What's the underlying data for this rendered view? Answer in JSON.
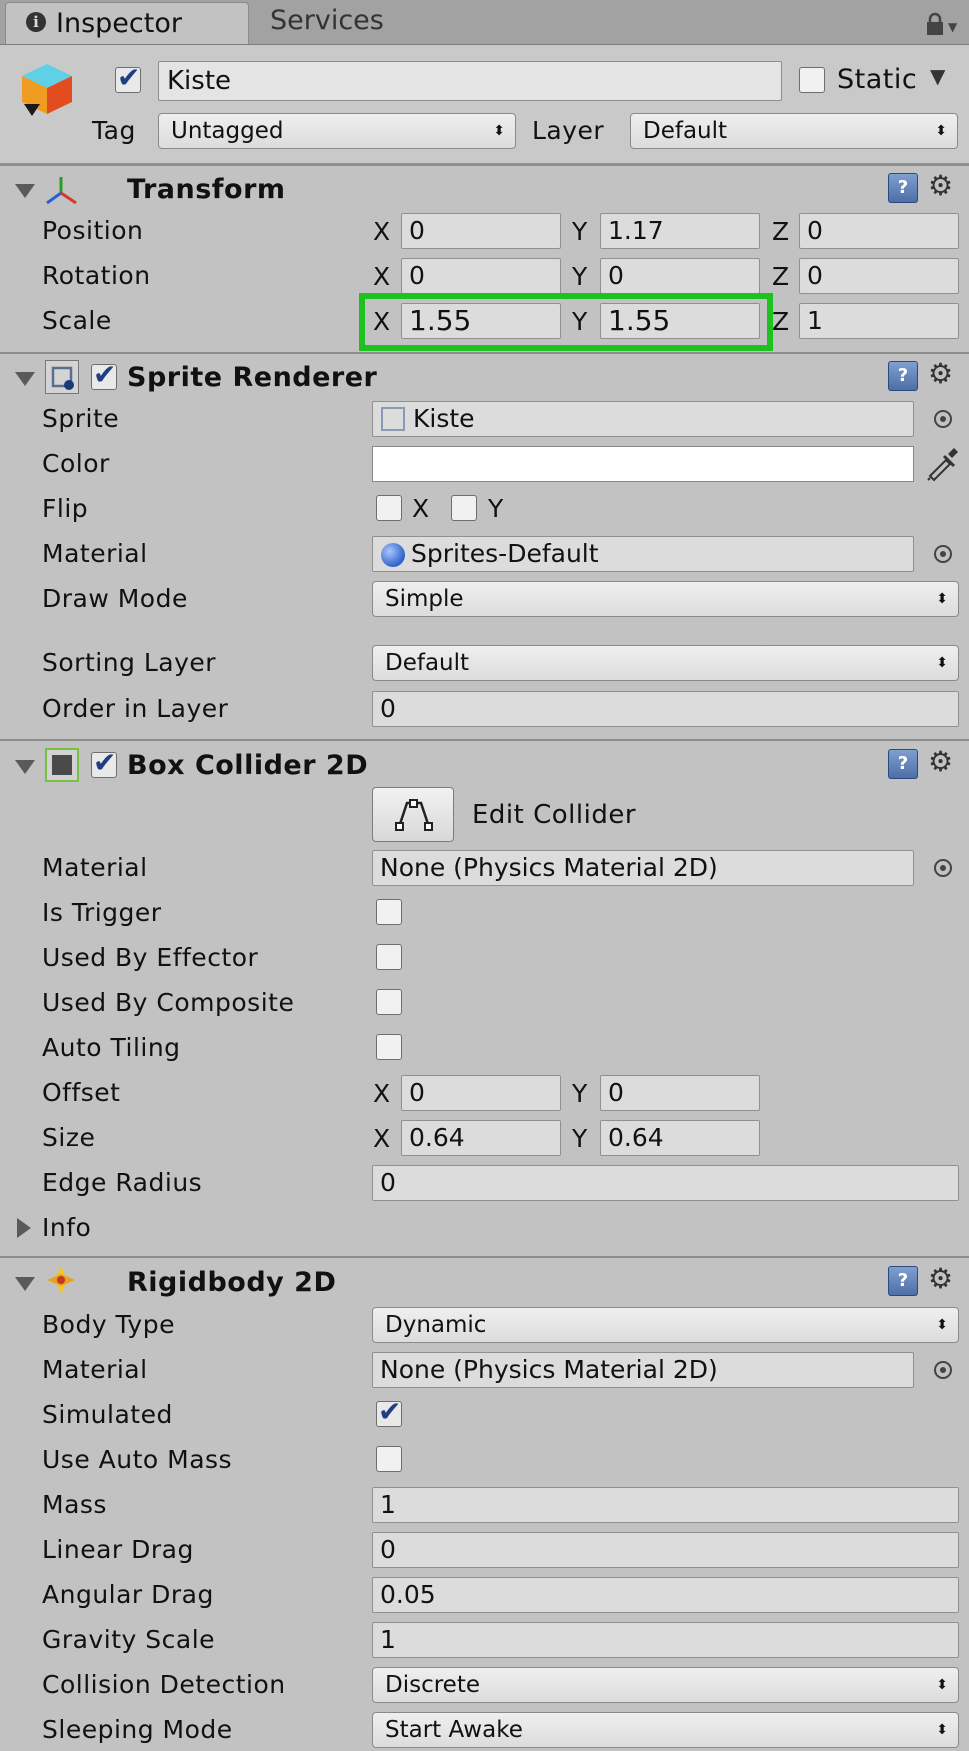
{
  "tabs": {
    "inspector": "Inspector",
    "services": "Services"
  },
  "object": {
    "name": "Kiste",
    "static_label": "Static",
    "tag_label": "Tag",
    "tag_value": "Untagged",
    "layer_label": "Layer",
    "layer_value": "Default"
  },
  "transform": {
    "title": "Transform",
    "position_label": "Position",
    "rotation_label": "Rotation",
    "scale_label": "Scale",
    "position": {
      "x": "0",
      "y": "1.17",
      "z": "0"
    },
    "rotation": {
      "x": "0",
      "y": "0",
      "z": "0"
    },
    "scale": {
      "x": "1.55",
      "y": "1.55",
      "z": "1"
    }
  },
  "axes": {
    "x": "X",
    "y": "Y",
    "z": "Z"
  },
  "sprite_renderer": {
    "title": "Sprite Renderer",
    "sprite_label": "Sprite",
    "sprite_value": "Kiste",
    "color_label": "Color",
    "color_value": "#ffffff",
    "flip_label": "Flip",
    "material_label": "Material",
    "material_value": "Sprites-Default",
    "draw_mode_label": "Draw Mode",
    "draw_mode_value": "Simple",
    "sorting_layer_label": "Sorting Layer",
    "sorting_layer_value": "Default",
    "order_label": "Order in Layer",
    "order_value": "0"
  },
  "box_collider": {
    "title": "Box Collider 2D",
    "edit_collider": "Edit Collider",
    "material_label": "Material",
    "material_value": "None (Physics Material 2D)",
    "is_trigger_label": "Is Trigger",
    "used_by_effector_label": "Used By Effector",
    "used_by_composite_label": "Used By Composite",
    "auto_tiling_label": "Auto Tiling",
    "offset_label": "Offset",
    "offset": {
      "x": "0",
      "y": "0"
    },
    "size_label": "Size",
    "size": {
      "x": "0.64",
      "y": "0.64"
    },
    "edge_radius_label": "Edge Radius",
    "edge_radius_value": "0",
    "info_label": "Info"
  },
  "rigidbody": {
    "title": "Rigidbody 2D",
    "body_type_label": "Body Type",
    "body_type_value": "Dynamic",
    "material_label": "Material",
    "material_value": "None (Physics Material 2D)",
    "simulated_label": "Simulated",
    "use_auto_mass_label": "Use Auto Mass",
    "mass_label": "Mass",
    "mass_value": "1",
    "linear_drag_label": "Linear Drag",
    "linear_drag_value": "0",
    "angular_drag_label": "Angular Drag",
    "angular_drag_value": "0.05",
    "gravity_scale_label": "Gravity Scale",
    "gravity_scale_value": "1",
    "collision_detection_label": "Collision Detection",
    "collision_detection_value": "Discrete",
    "sleeping_mode_label": "Sleeping Mode",
    "sleeping_mode_value": "Start Awake"
  },
  "colors": {
    "highlight": "#1ec21e",
    "panel": "#c2c2c2",
    "checkmark": "#1f3f82"
  },
  "icons": [
    "info-icon",
    "lock-icon",
    "cube-icon",
    "transform-axes-icon",
    "help-icon",
    "gear-icon",
    "sprite-renderer-icon",
    "box-collider-icon",
    "rigidbody-icon",
    "object-picker-icon",
    "eyedropper-icon",
    "sprite-asset-icon",
    "material-sphere-icon",
    "edit-collider-icon"
  ]
}
